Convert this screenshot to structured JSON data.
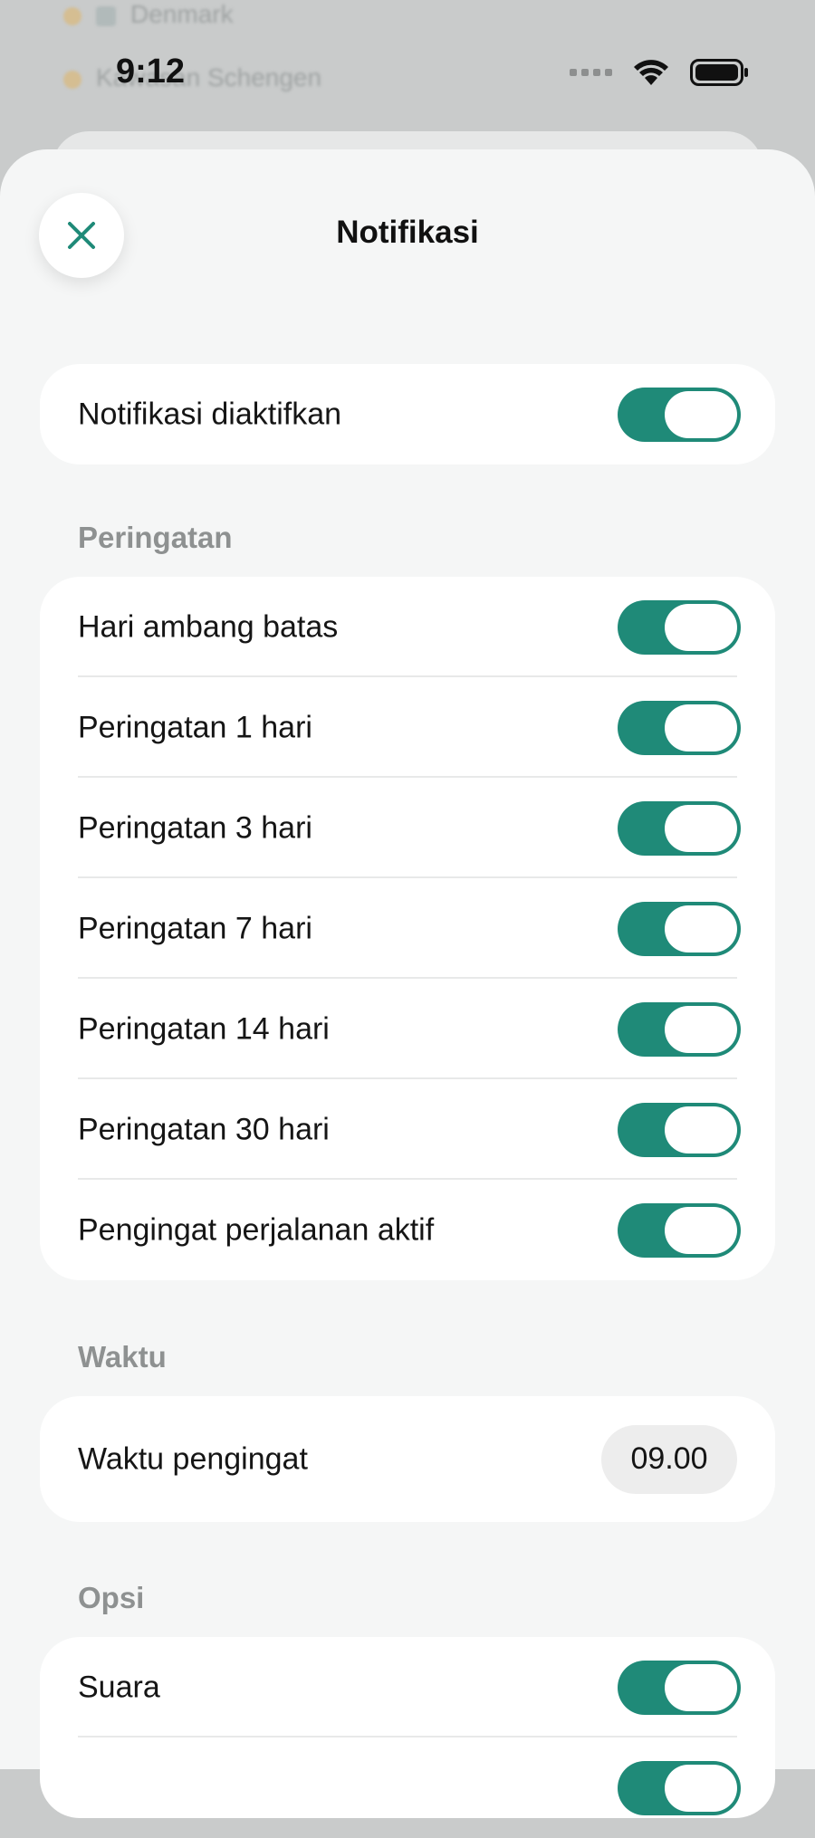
{
  "status_bar": {
    "time": "9:12"
  },
  "background": {
    "row1_text": "Denmark",
    "row1_right": "",
    "row2_text": "Kawasan Schengen"
  },
  "sheet": {
    "title": "Notifikasi"
  },
  "master": {
    "label": "Notifikasi diaktifkan",
    "enabled": true
  },
  "sections": {
    "warnings": {
      "title": "Peringatan",
      "items": [
        {
          "label": "Hari ambang batas",
          "enabled": true
        },
        {
          "label": "Peringatan 1 hari",
          "enabled": true
        },
        {
          "label": "Peringatan 3 hari",
          "enabled": true
        },
        {
          "label": "Peringatan 7 hari",
          "enabled": true
        },
        {
          "label": "Peringatan 14 hari",
          "enabled": true
        },
        {
          "label": "Peringatan 30 hari",
          "enabled": true
        },
        {
          "label": "Pengingat perjalanan aktif",
          "enabled": true
        }
      ]
    },
    "time": {
      "title": "Waktu",
      "label": "Waktu pengingat",
      "value": "09.00"
    },
    "options": {
      "title": "Opsi",
      "items": [
        {
          "label": "Suara",
          "enabled": true
        },
        {
          "label": "",
          "enabled": true
        }
      ]
    }
  },
  "colors": {
    "accent": "#1f8a78",
    "sheet_bg": "#f5f6f6",
    "card_bg": "#ffffff",
    "section_title": "#8e9191"
  },
  "icons": {
    "close": "close-icon",
    "wifi": "wifi-icon",
    "battery": "battery-icon",
    "signal": "signal-icon"
  }
}
